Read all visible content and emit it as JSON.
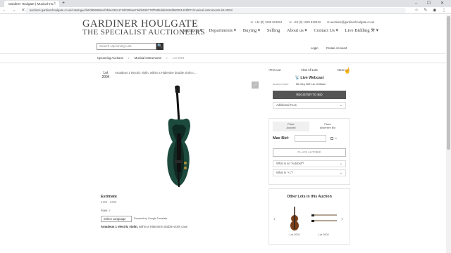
{
  "browser": {
    "tab_title": "Gardiner Houlgate | Musical Ins...",
    "tab_close": "×",
    "new_tab": "+",
    "window_controls": "– ☐ ✕",
    "nav_buttons": "← → ✕",
    "url": "auctions.gardinerhoulgate.co.uk/catalogue/lot/d856965e4f4b9e346c172d3309aa73ebb92b778f766bdafe918d380091429f071/musical-instruments-lot-2004/",
    "icons": "☆ ✎ ◉ ⋮"
  },
  "header": {
    "phone1": "☏ +44 (0) 1225 812912",
    "phone2": "☏ +44 (0) 1225 812913",
    "email": "✉ auctions@gardinerhoulgate.co.uk",
    "logo_line1": "GARDINER HOULGATE",
    "logo_line2": "THE SPECIALIST AUCTIONEERS",
    "nav": [
      "Auctions ▾",
      "Departments ▾",
      "Buying ▾",
      "Selling",
      "About us ▾",
      "Contact Us ▾",
      "Live Bidding ⚒ ▾"
    ],
    "search_placeholder": "Search Upcoming Lots",
    "search_icon": "🔍",
    "login": "Login",
    "create_account": "Create Account"
  },
  "breadcrumb": {
    "items": [
      "Upcoming Auctions",
      "Musical Instruments"
    ],
    "current": "Lot 2004"
  },
  "lot": {
    "badge_label": "Lot",
    "badge_number": "2004",
    "title": "Amadeus 1 electric violin, within a Hidersine double violin c...",
    "zoom_icon": "⤢",
    "prev": "‹ Prev Lot",
    "view_all": "View All Lots",
    "next": "Next Lot ›",
    "estimate_label": "Estimate",
    "estimate_value": "£120 - £200",
    "fees_label": "Fees ⓘ",
    "language_select": "Select Language",
    "powered_by": "Powered by Google Translate",
    "description_bold": "Amadeus 1 electric violin,",
    "description_rest": " within a Hidersine double violin case"
  },
  "bidding": {
    "webcast": "📡 Live Webcast",
    "auction_date_label": "Auction Date:",
    "auction_date": "9th Sep 2021 at 10:00am",
    "register_button": "REGISTER TO BID",
    "additional_fees": "Additional Fees",
    "tab1_line1": "Place",
    "tab1_line2": "Autobid",
    "tab2_line1": "Place",
    "tab2_line2": "Absentee Bid",
    "max_bid": "Max Bid:",
    "checkbox_label": "to",
    "place_autobid": "PLACE AUTOBID",
    "faq1": "What is an 'Autobid'?",
    "faq2": "What is '+1'?"
  },
  "others": {
    "title": "Other Lots in this Auction",
    "lot1": "Lot 2001",
    "lot2": "Lot 2002",
    "prev_arrow": "‹",
    "next_arrow": "›"
  }
}
